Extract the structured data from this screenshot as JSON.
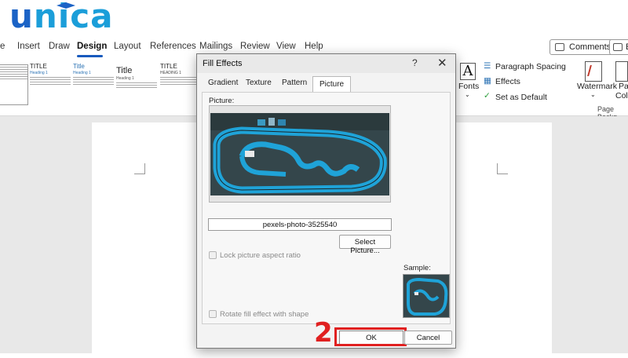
{
  "brand": {
    "letters": [
      "u",
      "n",
      "i",
      "c",
      "a"
    ]
  },
  "menu": {
    "items": [
      "e",
      "Insert",
      "Draw",
      "Design",
      "Layout",
      "References",
      "Mailings",
      "Review",
      "View",
      "Help"
    ],
    "active": "Design",
    "comments_label": "Comments",
    "edit_label": "E"
  },
  "ribbon": {
    "thumbs": [
      {
        "title": "",
        "sub": ""
      },
      {
        "title": "TITLE",
        "sub": "Heading 1"
      },
      {
        "title": "Title",
        "sub": "Heading 1"
      },
      {
        "title": "Title",
        "sub": "Heading 1"
      },
      {
        "title": "TITLE",
        "sub": "HEADING 1"
      }
    ],
    "fonts_label": "Fonts",
    "fonts_glyph": "A",
    "paragraph_spacing": "Paragraph Spacing",
    "effects": "Effects",
    "set_default": "Set as Default",
    "watermark": "Watermark",
    "page_color_1": "Pa",
    "page_color_2": "Colo",
    "page_background": "Page Backg"
  },
  "dialog": {
    "title": "Fill Effects",
    "help": "?",
    "close": "✕",
    "tabs": [
      "Gradient",
      "Texture",
      "Pattern",
      "Picture"
    ],
    "active_tab": "Picture",
    "picture_label": "Picture:",
    "filename": "pexels-photo-3525540",
    "select_picture": "Select Picture...",
    "lock_aspect": "Lock picture aspect ratio",
    "sample_label": "Sample:",
    "rotate_fill": "Rotate fill effect with shape",
    "ok": "OK",
    "cancel": "Cancel"
  },
  "annotation": {
    "step": "2"
  },
  "colors": {
    "accent": "#185abd",
    "highlight": "#e02020",
    "brand": "#1b9ed9"
  }
}
